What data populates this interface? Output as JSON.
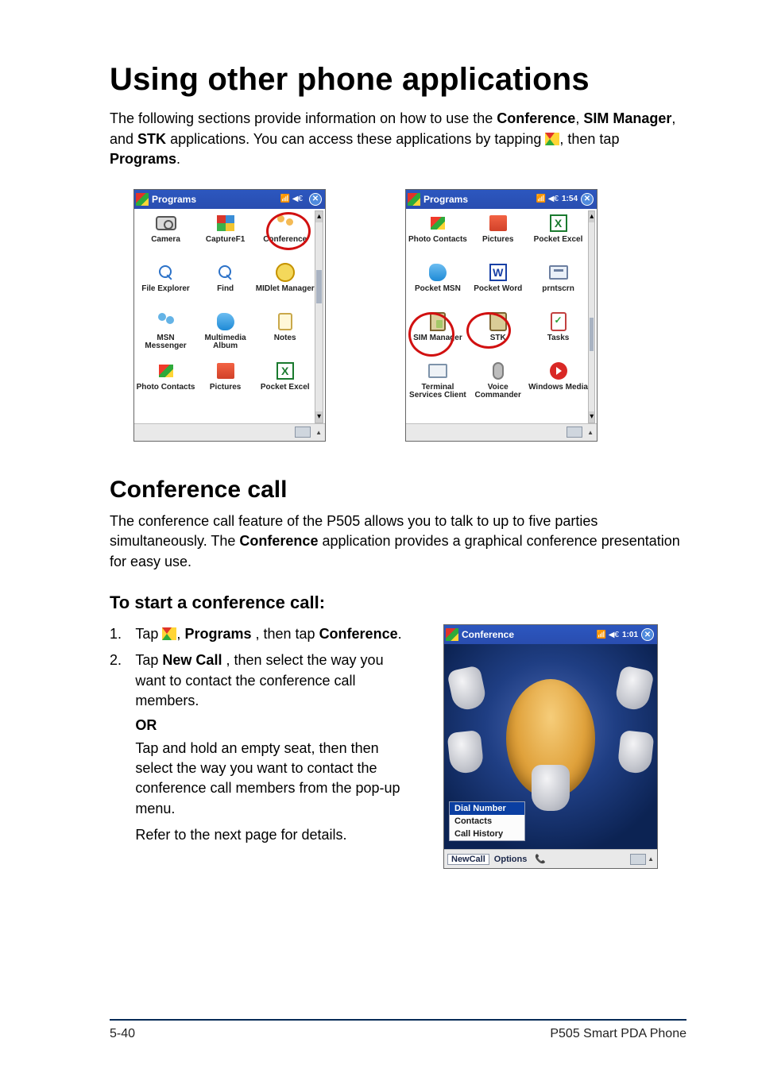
{
  "h1": "Using other phone applications",
  "intro": {
    "pre": "The following sections provide information on how to use the ",
    "app1": "Conference",
    "sep1": ", ",
    "app2": "SIM Manager",
    "sep2": ", and ",
    "app3": "STK",
    "tail": " applications. You can access these applications by tapping ",
    "then_tap": ", then tap ",
    "programs": "Programs",
    "end": "."
  },
  "screens": {
    "left": {
      "title": "Programs",
      "time": "",
      "apps": [
        "Camera",
        "CaptureF1",
        "Conference",
        "File Explorer",
        "Find",
        "MIDlet Manager",
        "MSN Messenger",
        "Multimedia Album",
        "Notes",
        "Photo Contacts",
        "Pictures",
        "Pocket Excel"
      ]
    },
    "right": {
      "title": "Programs",
      "time": "1:54",
      "apps": [
        "Photo Contacts",
        "Pictures",
        "Pocket Excel",
        "Pocket MSN",
        "Pocket Word",
        "prntscrn",
        "SIM Manager",
        "STK",
        "Tasks",
        "Terminal Services Client",
        "Voice Commander",
        "Windows Media"
      ]
    }
  },
  "h2": "Conference call",
  "conf_p": {
    "a": "The conference call feature of the P505 allows you to talk to up to five parties simultaneously. The ",
    "b": "Conference",
    "c": " application provides a graphical conference presentation for easy use."
  },
  "h3": "To start a conference call:",
  "steps": {
    "s1": {
      "num": "1.",
      "a": "Tap ",
      "b": ", ",
      "c": "Programs",
      "d": ", then tap ",
      "e": "Conference",
      "f": "."
    },
    "s2": {
      "num": "2.",
      "a": "Tap ",
      "b": "New Call",
      "c": ", then select the way you want to contact the conference call members."
    },
    "or": "OR",
    "s2b": "Tap and hold an empty seat, then then select the way you want to contact the conference call members from the pop-up menu.",
    "s2c": "Refer to the next page for details."
  },
  "conf_screen": {
    "title": "Conference",
    "time": "1:01",
    "popup": {
      "dial": "Dial Number",
      "contacts": "Contacts",
      "history": "Call History"
    },
    "bottom": {
      "newcall": "NewCall",
      "options": "Options"
    }
  },
  "footer": {
    "left": "5-40",
    "right": "P505 Smart PDA Phone"
  }
}
